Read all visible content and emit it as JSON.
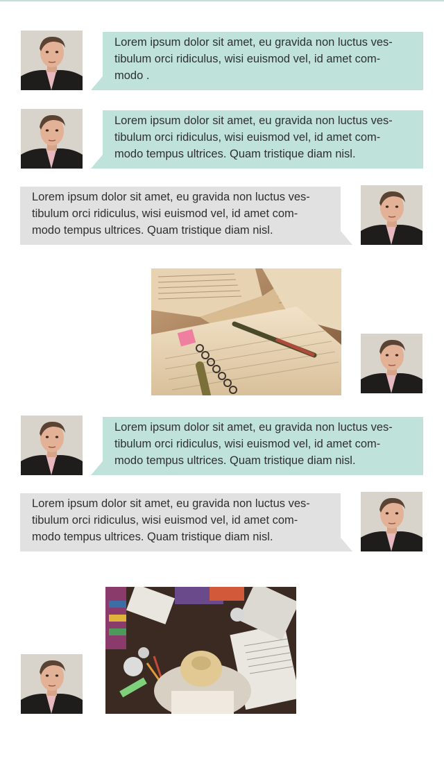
{
  "chat": {
    "messages": [
      {
        "side": "incoming",
        "text": "Lorem ipsum dolor sit amet, eu gravida non luctus ves-tibulum orci ridiculus, wisi euismod vel, id amet com-modo .",
        "lines": [
          "Lorem ipsum dolor sit amet, eu gravida non luctus ves-",
          "tibulum orci ridiculus, wisi euismod vel, id amet com-",
          "modo ."
        ]
      },
      {
        "side": "incoming",
        "text": "Lorem ipsum dolor sit amet, eu gravida non luctus ves-tibulum orci ridiculus, wisi euismod vel, id amet com-modo tempus ultrices. Quam tristique diam nisl.",
        "lines": [
          "Lorem ipsum dolor sit amet, eu gravida non luctus ves-",
          "tibulum orci ridiculus, wisi euismod vel, id amet com-",
          "modo tempus ultrices. Quam tristique diam nisl."
        ]
      },
      {
        "side": "outgoing",
        "text": "Lorem ipsum dolor sit amet, eu gravida non luctus ves-tibulum orci ridiculus, wisi euismod vel, id amet com-modo tempus ultrices. Quam tristique diam nisl.",
        "lines": [
          "Lorem ipsum dolor sit amet, eu gravida non luctus ves-",
          "tibulum orci ridiculus, wisi euismod vel, id amet com-",
          "modo tempus ultrices. Quam tristique diam nisl."
        ]
      },
      {
        "side": "outgoing",
        "type": "image",
        "image": "books-and-notebook-photo"
      },
      {
        "side": "incoming",
        "text": "Lorem ipsum dolor sit amet, eu gravida non luctus ves-tibulum orci ridiculus, wisi euismod vel, id amet com-modo tempus ultrices. Quam tristique diam nisl.",
        "lines": [
          "Lorem ipsum dolor sit amet, eu gravida non luctus ves-",
          "tibulum orci ridiculus, wisi euismod vel, id amet com-",
          "modo tempus ultrices. Quam tristique diam nisl."
        ]
      },
      {
        "side": "outgoing",
        "text": "Lorem ipsum dolor sit amet, eu gravida non luctus ves-tibulum orci ridiculus, wisi euismod vel, id amet com-modo tempus ultrices. Quam tristique diam nisl.",
        "lines": [
          "Lorem ipsum dolor sit amet, eu gravida non luctus ves-",
          "tibulum orci ridiculus, wisi euismod vel, id amet com-",
          "modo tempus ultrices. Quam tristique diam nisl."
        ]
      },
      {
        "side": "incoming",
        "type": "image",
        "image": "student-studying-desk-photo"
      }
    ]
  },
  "colors": {
    "incoming_bubble": "#bfe3db",
    "outgoing_bubble": "#e1e1e1",
    "text": "#2f2f2f",
    "background": "#ffffff"
  },
  "icons": {
    "avatar": "user-avatar-photo"
  }
}
